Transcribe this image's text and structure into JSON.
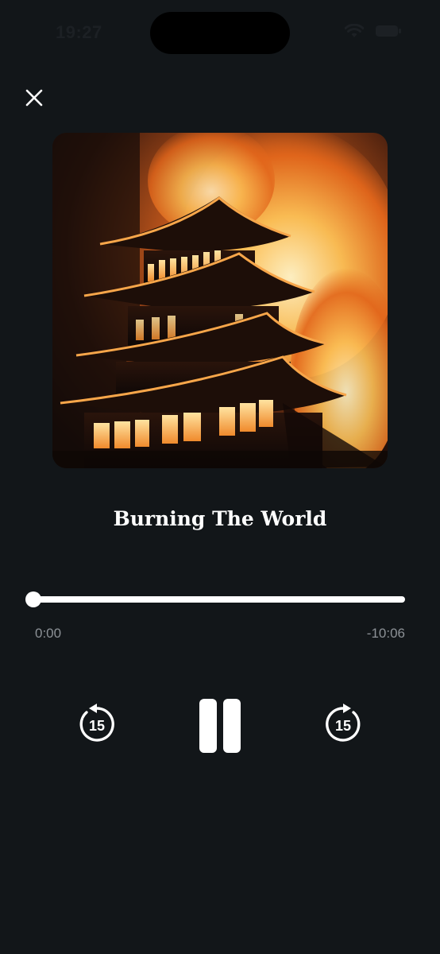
{
  "status_bar": {
    "time": "19:27"
  },
  "header": {
    "close_icon": "close-icon"
  },
  "player": {
    "title": "Burning The World",
    "artwork": "burning-pagoda-artwork",
    "elapsed": "0:00",
    "remaining": "-10:06",
    "progress_fraction": 0.0
  },
  "controls": {
    "skip_back_icon": "rewind-15-icon",
    "skip_back_seconds": "15",
    "play_pause_icon": "pause-icon",
    "skip_forward_icon": "forward-15-icon",
    "skip_forward_seconds": "15"
  },
  "colors": {
    "background": "#121619",
    "foreground": "#ffffff",
    "secondary_text": "#8c9196"
  }
}
